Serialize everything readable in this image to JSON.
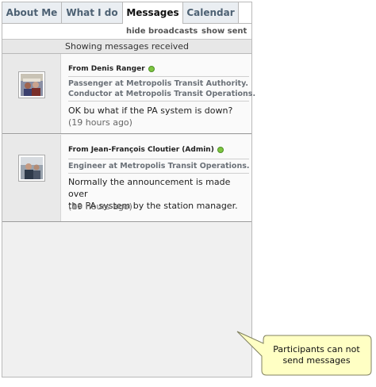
{
  "tabs": [
    {
      "label": "About Me"
    },
    {
      "label": "What I do"
    },
    {
      "label": "Messages",
      "active": true
    },
    {
      "label": "Calendar"
    }
  ],
  "actions": {
    "hide_broadcasts": "hide broadcasts",
    "show_sent": "show sent"
  },
  "status": "Showing messages received",
  "messages": [
    {
      "from": "From Denis Ranger",
      "online": true,
      "role_line1": "Passenger at Metropolis Transit Authority.",
      "role_line2": "Conductor at Metropolis Transit Operations.",
      "body": "OK bu what if the PA system is down?",
      "time": "(19 hours ago)"
    },
    {
      "from": "From Jean-François Cloutier (Admin)",
      "online": true,
      "role_line1": "Engineer at Metropolis Transit Operations.",
      "body_line1": "Normally the announcement is made over",
      "body_line2": "the PA system by the station manager.",
      "time": "(19 hours ago)"
    }
  ],
  "callout": {
    "line1": "Participants can not",
    "line2": "send messages",
    "fill": "#ffffc4"
  },
  "colors": {
    "online_dot": "#7ec640",
    "tab_text": "#4d6173"
  }
}
